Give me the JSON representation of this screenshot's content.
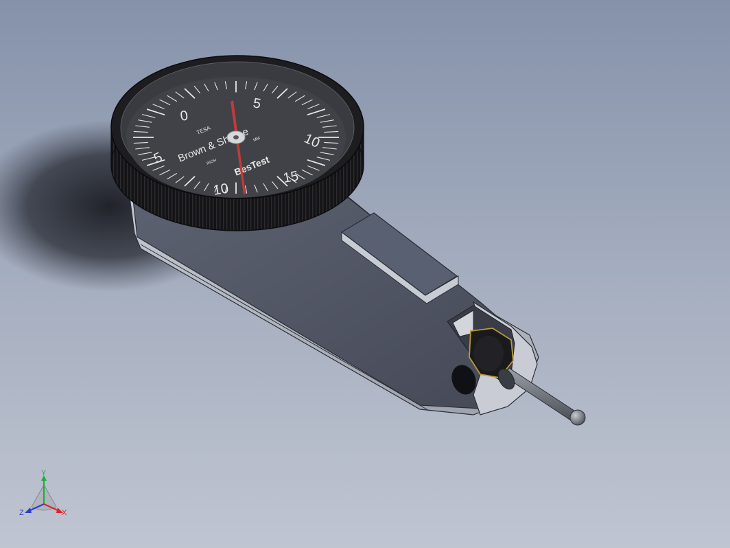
{
  "dial": {
    "brand": "Brown & Sharpe",
    "model": "BesTest",
    "scale_numbers": [
      "0",
      "5",
      "10",
      "15",
      "5"
    ],
    "small_marks": [
      "TESA",
      "INCH",
      "MM"
    ]
  },
  "triad": {
    "x_label": "X",
    "y_label": "Y",
    "z_label": "Z"
  },
  "colors": {
    "background_top": "#8592aa",
    "background_bottom": "#bfc5d1",
    "body": "#4e5362",
    "dial_face": "#3f4045",
    "bezel": "#1a1a1c",
    "pointer": "#c23a3a"
  }
}
